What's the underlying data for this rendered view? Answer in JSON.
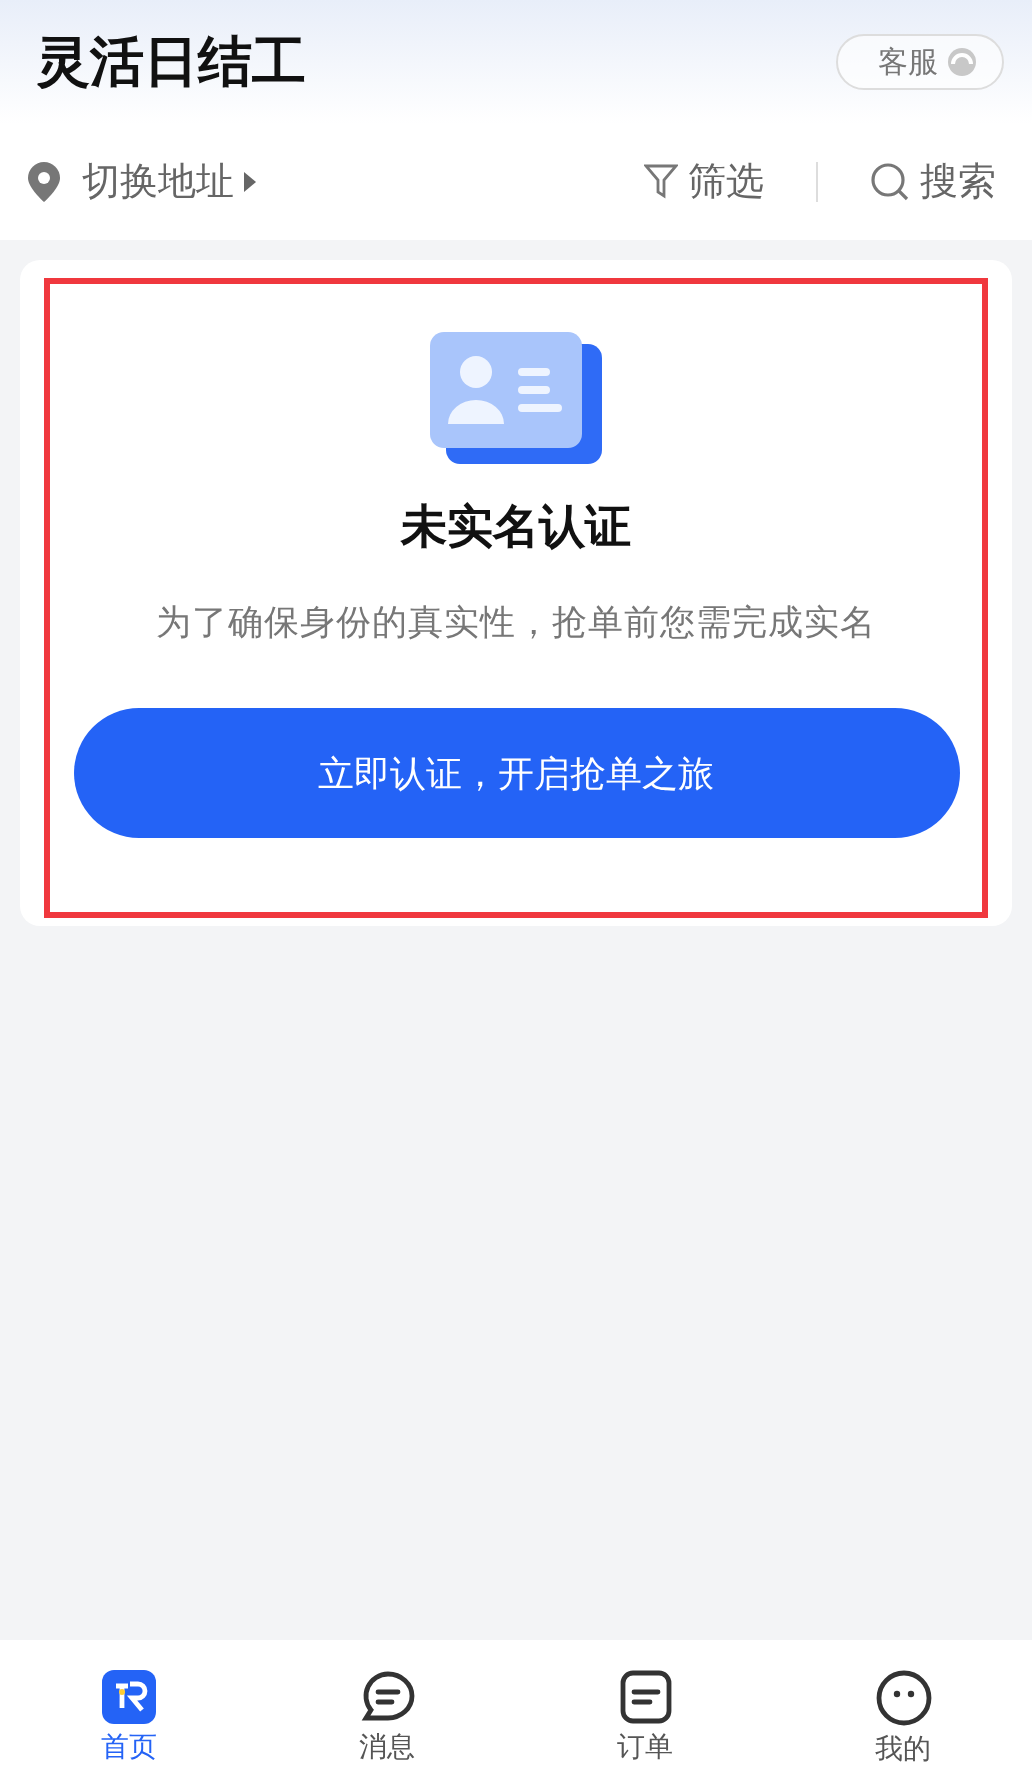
{
  "header": {
    "title": "灵活日结工",
    "service_button": "客服"
  },
  "toolbar": {
    "location": "切换地址",
    "filter": "筛选",
    "search": "搜索"
  },
  "verify_card": {
    "title": "未实名认证",
    "description": "为了确保身份的真实性，抢单前您需完成实名",
    "button": "立即认证，开启抢单之旅"
  },
  "tabs": [
    {
      "kind": "home",
      "label": "首页",
      "selected": true
    },
    {
      "kind": "message",
      "label": "消息",
      "selected": false
    },
    {
      "kind": "order",
      "label": "订单",
      "selected": false
    },
    {
      "kind": "profile",
      "label": "我的",
      "selected": false
    }
  ]
}
